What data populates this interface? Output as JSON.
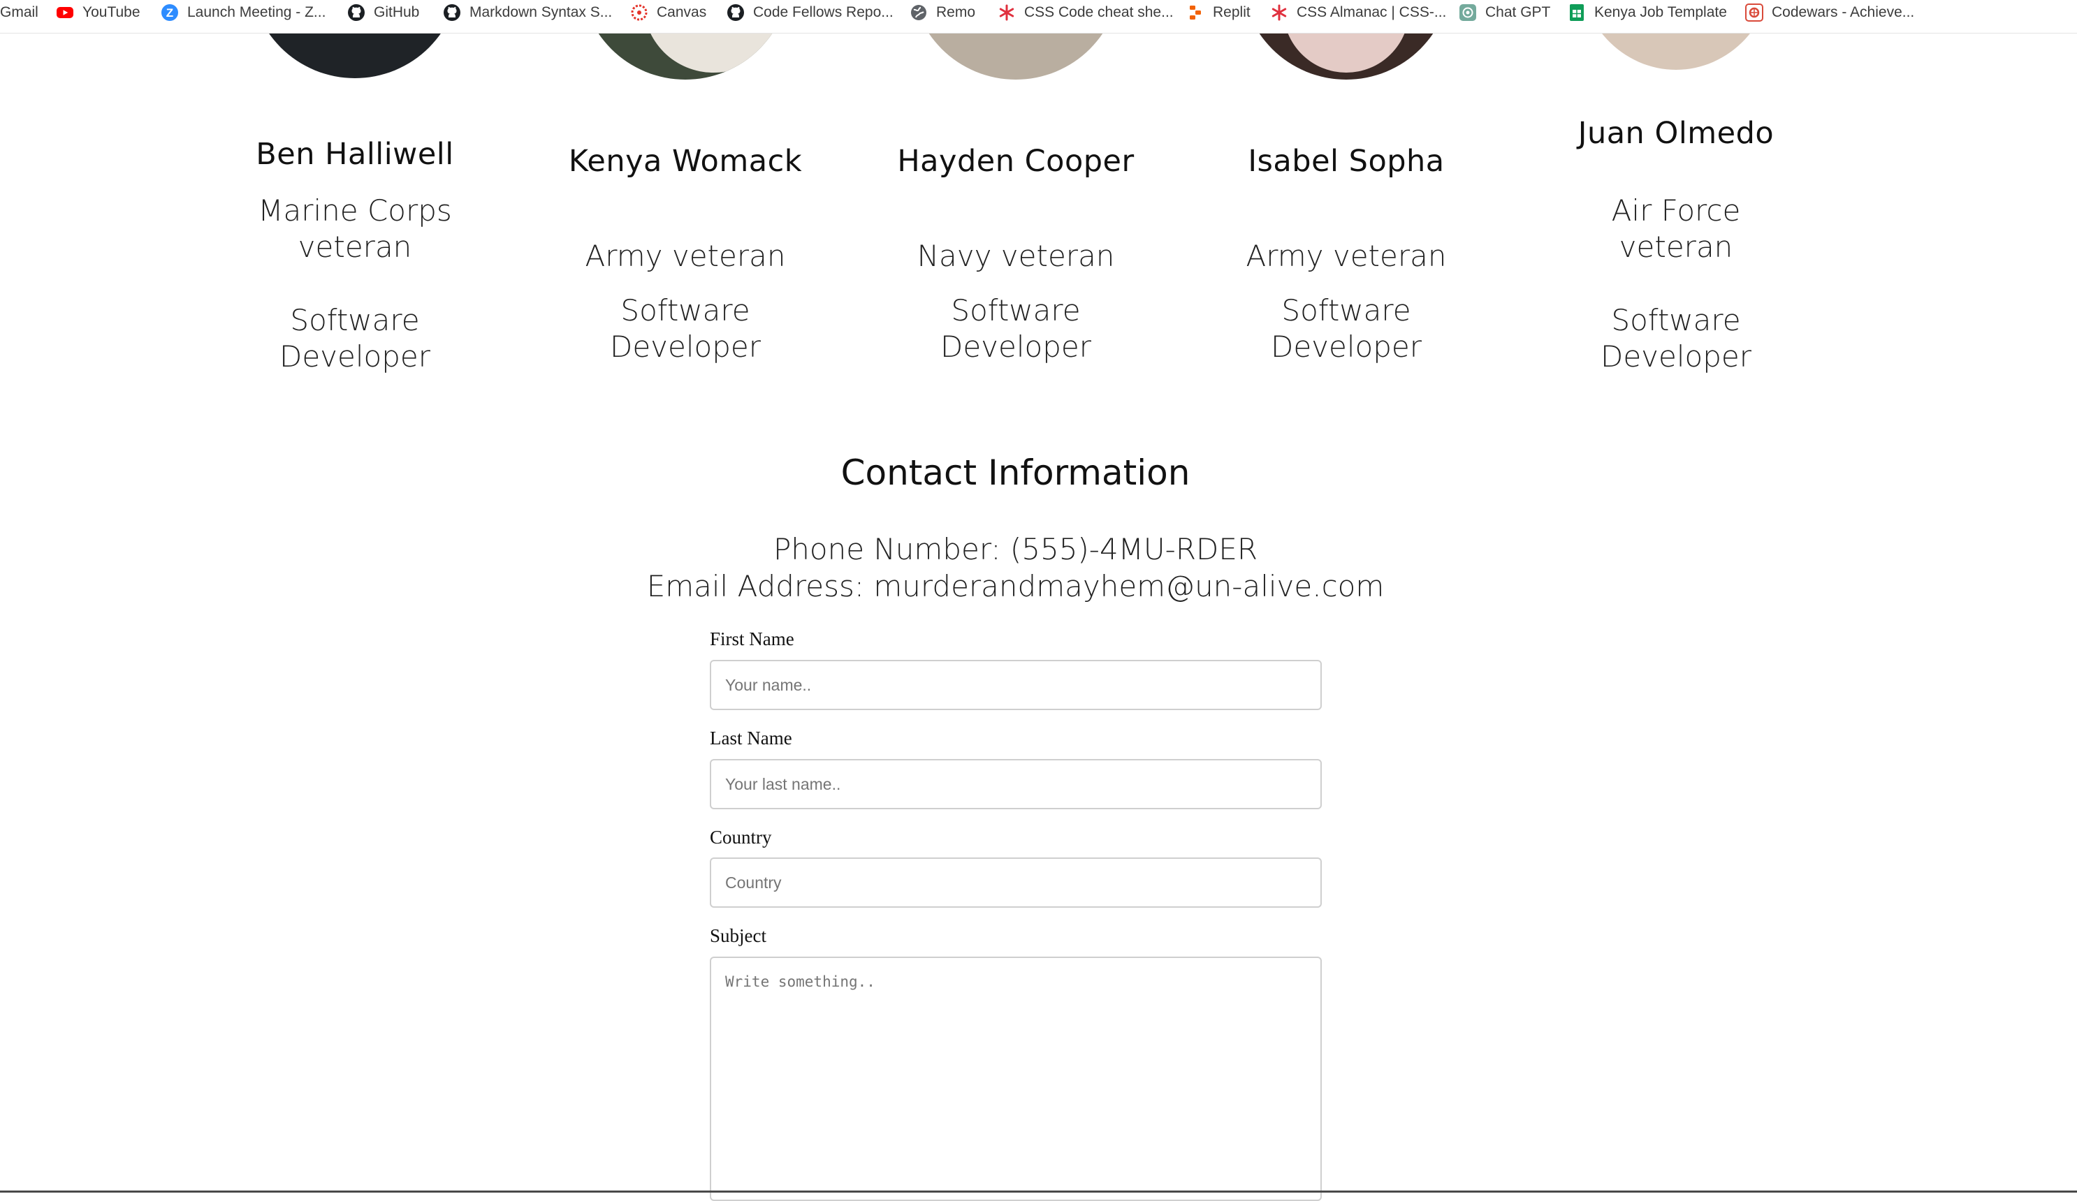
{
  "bookmarks": [
    {
      "label": "Gmail",
      "icon": "gmail-icon"
    },
    {
      "label": "YouTube",
      "icon": "youtube-icon"
    },
    {
      "label": "Launch Meeting - Z...",
      "icon": "zoom-icon"
    },
    {
      "label": "GitHub",
      "icon": "github-icon"
    },
    {
      "label": "Markdown Syntax S...",
      "icon": "github-icon"
    },
    {
      "label": "Canvas",
      "icon": "canvas-icon"
    },
    {
      "label": "Code Fellows Repo...",
      "icon": "github-icon"
    },
    {
      "label": "Remo",
      "icon": "globe-icon"
    },
    {
      "label": "CSS Code cheat she...",
      "icon": "asterisk-icon"
    },
    {
      "label": "Replit",
      "icon": "replit-icon"
    },
    {
      "label": "CSS Almanac | CSS-...",
      "icon": "asterisk-icon"
    },
    {
      "label": "Chat GPT",
      "icon": "chatgpt-icon"
    },
    {
      "label": "Kenya Job Template",
      "icon": "sheets-icon"
    },
    {
      "label": "Codewars - Achieve...",
      "icon": "codewars-icon"
    }
  ],
  "team": [
    {
      "name": "Ben Halliwell",
      "branch": "Marine Corps veteran",
      "role": "Software Developer"
    },
    {
      "name": "Kenya Womack",
      "branch": "Army veteran",
      "role": "Software Developer"
    },
    {
      "name": "Hayden Cooper",
      "branch": "Navy veteran",
      "role": "Software Developer"
    },
    {
      "name": "Isabel Sopha",
      "branch": "Army veteran",
      "role": "Software Developer"
    },
    {
      "name": "Juan Olmedo",
      "branch": "Air Force veteran",
      "role": "Software Developer"
    }
  ],
  "contact": {
    "title": "Contact Information",
    "phone": "Phone Number: (555)-4MU-RDER",
    "email": "Email Address: murderandmayhem@un-alive.com"
  },
  "form": {
    "first_name": {
      "label": "First Name",
      "placeholder": "Your name..",
      "value": ""
    },
    "last_name": {
      "label": "Last Name",
      "placeholder": "Your last name..",
      "value": ""
    },
    "country": {
      "label": "Country",
      "placeholder": "Country",
      "value": ""
    },
    "subject": {
      "label": "Subject",
      "placeholder": "Write something..",
      "value": ""
    }
  },
  "colors": {
    "youtube_red": "#ff0000",
    "zoom_blue": "#2d8cff",
    "canvas_red": "#e4332a",
    "replit_orange": "#f26207",
    "sheets_green": "#0f9d58",
    "codewars_red": "#d94a3a",
    "input_border": "#cfcfcf"
  }
}
